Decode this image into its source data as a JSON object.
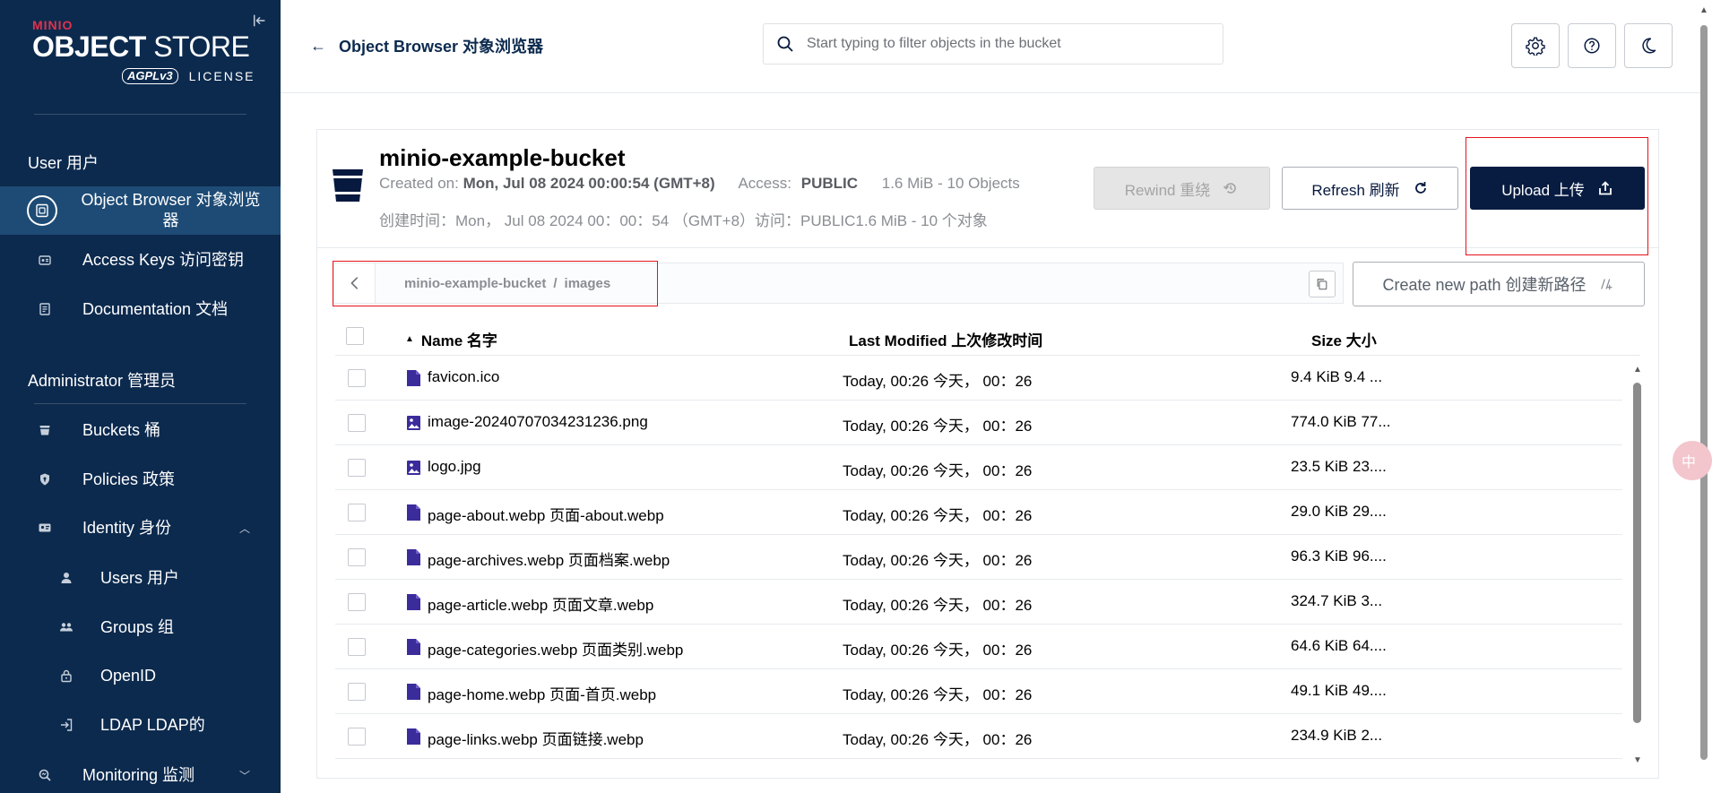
{
  "sidebar": {
    "logo": {
      "brand": "MINIO",
      "product_bold": "OBJECT",
      "product_light": " STORE",
      "agpl": "AGPLv3",
      "license": "LICENSE"
    },
    "user_section": "User 用户",
    "admin_section": "Administrator 管理员",
    "items": [
      {
        "label": "Object Browser 对象浏览器",
        "icon": "object-browser-icon"
      },
      {
        "label": "Access Keys 访问密钥",
        "icon": "key-icon"
      },
      {
        "label": "Documentation 文档",
        "icon": "document-icon"
      },
      {
        "label": "Buckets 桶",
        "icon": "bucket-icon"
      },
      {
        "label": "Policies 政策",
        "icon": "shield-icon"
      },
      {
        "label": "Identity 身份",
        "icon": "identity-icon"
      },
      {
        "label": "Users 用户",
        "icon": "user-icon"
      },
      {
        "label": "Groups 组",
        "icon": "group-icon"
      },
      {
        "label": "OpenID",
        "icon": "lock-icon"
      },
      {
        "label": "LDAP LDAP的",
        "icon": "login-icon"
      },
      {
        "label": "Monitoring 监测",
        "icon": "monitoring-icon"
      }
    ]
  },
  "header": {
    "back_label": "Object Browser 对象浏览器",
    "search_placeholder": "Start typing to filter objects in the bucket"
  },
  "bucket": {
    "name": "minio-example-bucket",
    "created_label": "Created on:",
    "created_value": "Mon, Jul 08 2024 00:00:54 (GMT+8)",
    "access_label": "Access:",
    "access_value": "PUBLIC",
    "summary": "1.6 MiB - 10 Objects",
    "translated_meta": "创建时间：Mon， Jul 08 2024 00：00：54 （GMT+8）访问：PUBLIC1.6 MiB - 10 个对象",
    "rewind_label": "Rewind 重绕",
    "refresh_label": "Refresh 刷新",
    "upload_label": "Upload 上传"
  },
  "breadcrumb": {
    "bucket": "minio-example-bucket",
    "separator": "/",
    "folder": "images",
    "new_path_label": "Create new path 创建新路径"
  },
  "table": {
    "col_name": "Name 名字",
    "col_modified": "Last Modified 上次修改时间",
    "col_size": "Size 大小",
    "rows": [
      {
        "name": "favicon.ico",
        "type": "file",
        "modified": "Today, 00:26 今天， 00：26",
        "size": "9.4 KiB 9.4 ..."
      },
      {
        "name": "image-20240707034231236.png",
        "type": "image",
        "modified": "Today, 00:26 今天， 00：26",
        "size": "774.0 KiB 77..."
      },
      {
        "name": "logo.jpg",
        "type": "image",
        "modified": "Today, 00:26 今天， 00：26",
        "size": "23.5 KiB 23...."
      },
      {
        "name": "page-about.webp 页面-about.webp",
        "type": "file",
        "modified": "Today, 00:26 今天， 00：26",
        "size": "29.0 KiB 29...."
      },
      {
        "name": "page-archives.webp 页面档案.webp",
        "type": "file",
        "modified": "Today, 00:26 今天， 00：26",
        "size": "96.3 KiB 96...."
      },
      {
        "name": "page-article.webp 页面文章.webp",
        "type": "file",
        "modified": "Today, 00:26 今天， 00：26",
        "size": "324.7 KiB 3..."
      },
      {
        "name": "page-categories.webp 页面类别.webp",
        "type": "file",
        "modified": "Today, 00:26 今天， 00：26",
        "size": "64.6 KiB 64...."
      },
      {
        "name": "page-home.webp 页面-首页.webp",
        "type": "file",
        "modified": "Today, 00:26 今天， 00：26",
        "size": "49.1 KiB 49...."
      },
      {
        "name": "page-links.webp 页面链接.webp",
        "type": "file",
        "modified": "Today, 00:26 今天， 00：26",
        "size": "234.9 KiB 2..."
      }
    ]
  },
  "floating_badge": "中",
  "colors": {
    "sidebar_bg": "#0c2a4e",
    "accent": "#081c42",
    "file_icon": "#3b2c9c",
    "highlight_box": "#e5131d"
  }
}
